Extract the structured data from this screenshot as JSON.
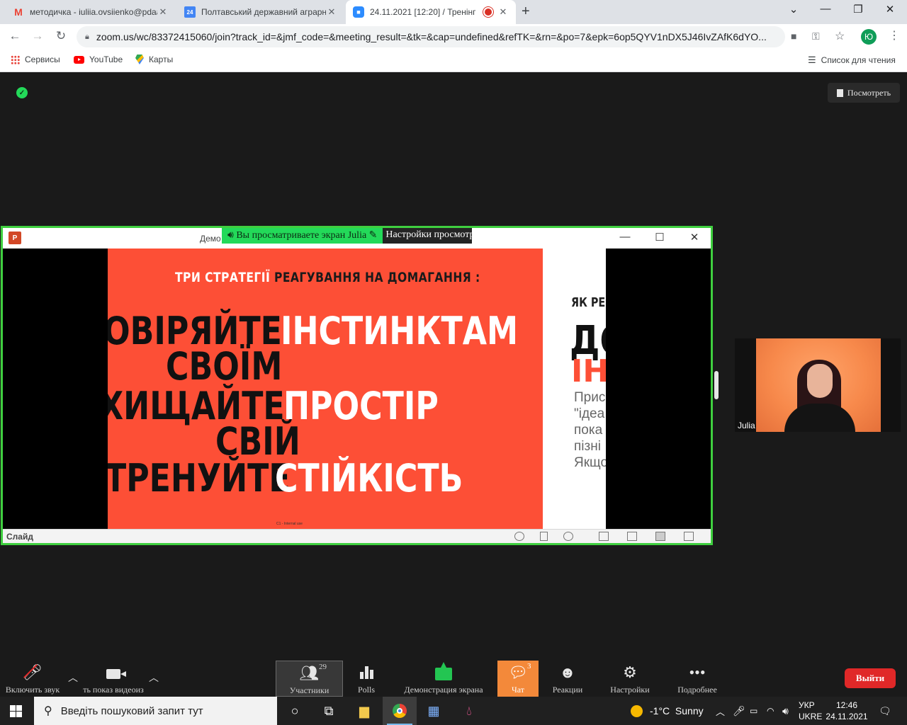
{
  "browser": {
    "tabs": [
      {
        "title": "методичка - iuliia.ovsiienko@pdaa...",
        "icon": "gmail-icon"
      },
      {
        "title": "Полтавський державний аграрний...",
        "icon": "calendar-icon"
      },
      {
        "title": "24.11.2021 [12:20] / Тренінг",
        "icon": "zoom-icon",
        "active": true
      }
    ],
    "url": "zoom.us/wc/83372415060/join?track_id=&jmf_code=&meeting_result=&tk=&cap=undefined&refTK=&rn=&po=7&epk=6op5QYV1nDX5J46IvZAfK6dYO...",
    "profile_initial": "Ю",
    "bookmarks": [
      "Сервисы",
      "YouTube",
      "Карты"
    ],
    "reading_list": "Список для чтения"
  },
  "zoom": {
    "view_button": "Посмотреть",
    "viewing_banner": "Вы просматриваете экран Julia",
    "view_settings": "Настройки просмотра",
    "ppt_title": "Демо",
    "slide_status": "Слайд",
    "slide": {
      "heading_white": "ТРИ СТРАТЕГІЇ",
      "heading_dark": "РЕАГУВАННЯ НА ДОМАГАННЯ :",
      "line1_dark": "ОВІРЯЙТЕ",
      "line1_white": "ІНСТИНКТАМ",
      "line2_dark": "СВОЇМ",
      "line3_dark": "ХИЩАЙТЕ",
      "line3_white": "ПРОСТІР",
      "line4_dark": "СВІЙ",
      "line5_dark": "ТРЕНУЙТЕ",
      "line5_white": "СТІЙКІСТЬ",
      "footer": "C1 - Internal use"
    },
    "next_slide": {
      "top": "ЯК РЕ",
      "big": "ДО",
      "red": "ІН",
      "p1": "Прис",
      "p2": "\"ідеа",
      "p3": "пока",
      "p4": "пізні",
      "p5": "Якщо"
    },
    "participant_name": "Julia",
    "toolbar": {
      "mute": "Включить звук",
      "video": "ть показ видеоиз",
      "participants": "Участники",
      "participants_count": "29",
      "polls": "Polls",
      "share": "Демонстрация экрана",
      "chat": "Чат",
      "chat_count": "3",
      "reactions": "Реакции",
      "settings": "Настройки",
      "more": "Подробнее",
      "exit": "Выйти"
    }
  },
  "taskbar": {
    "search_placeholder": "Введіть пошуковий запит тут",
    "weather": "-1°C  Sunny",
    "lang1": "УКР",
    "lang2": "UKRE",
    "time": "12:46",
    "date": "24.11.2021"
  },
  "colors": {
    "slide_bg": "#fd4f36",
    "share_border": "#3fcf3f",
    "chat_active": "#f3893a",
    "exit": "#e02828"
  }
}
